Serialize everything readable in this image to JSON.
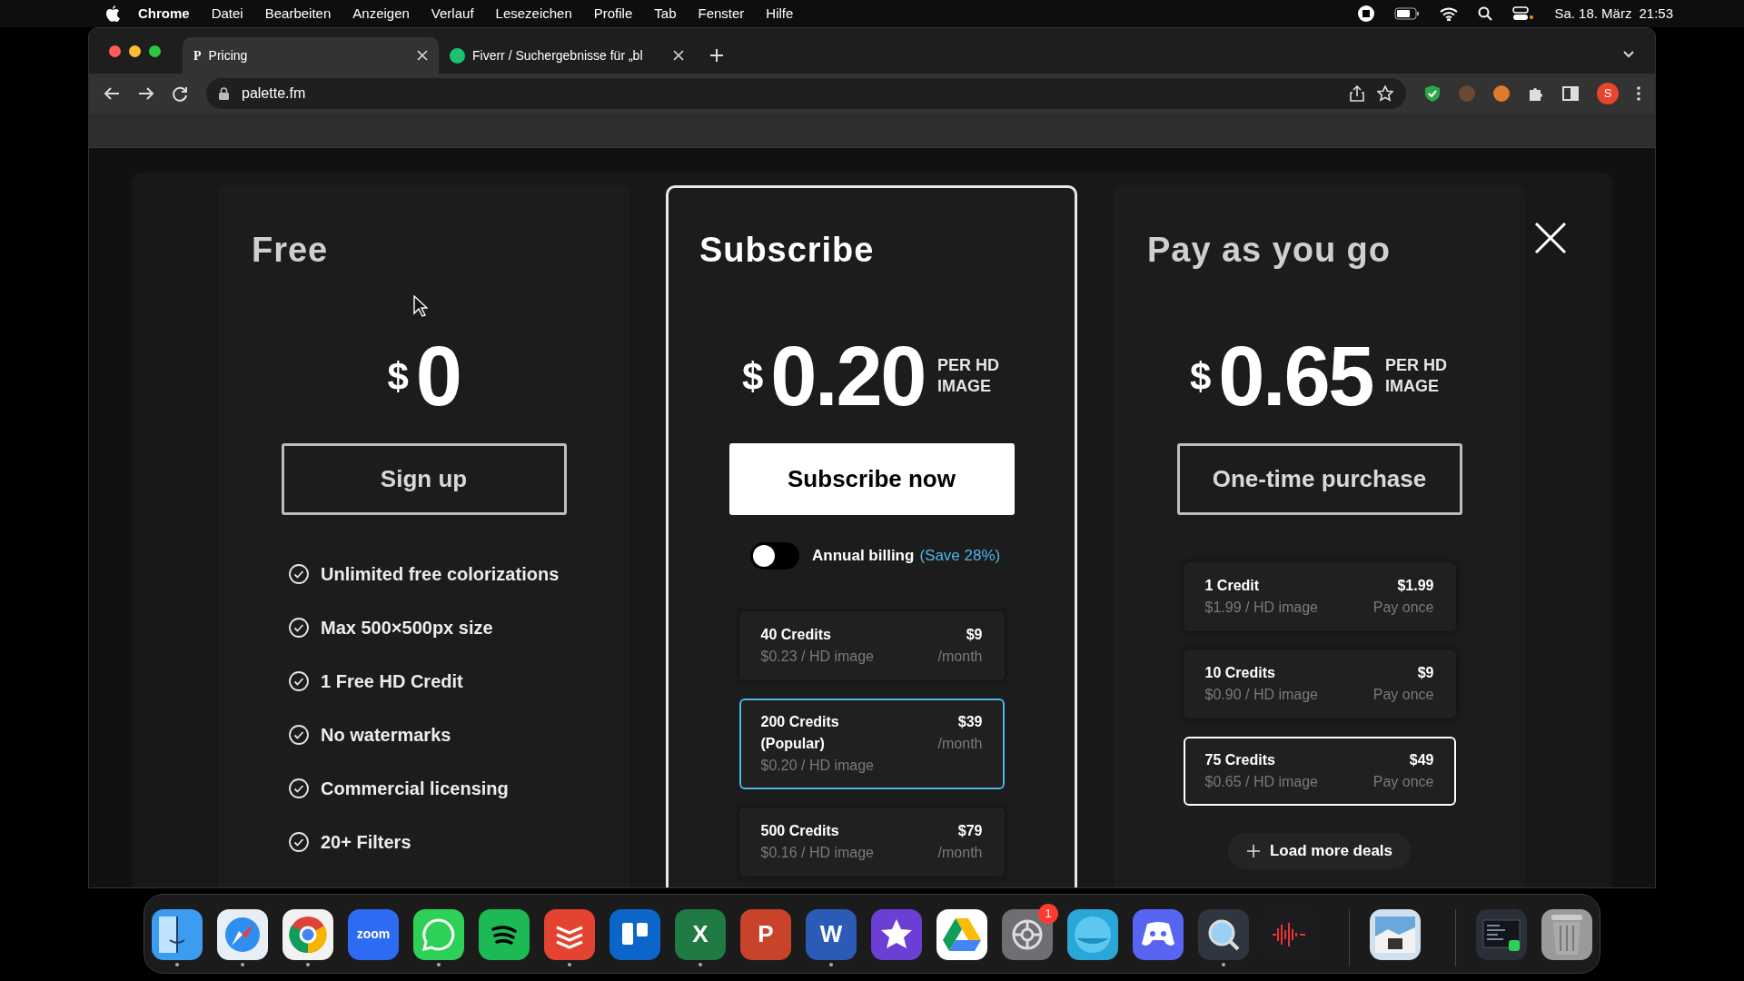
{
  "menu_bar": {
    "app": "Chrome",
    "items": [
      "Datei",
      "Bearbeiten",
      "Anzeigen",
      "Verlauf",
      "Lesezeichen",
      "Profile",
      "Tab",
      "Fenster",
      "Hilfe"
    ],
    "date": "Sa. 18. März",
    "time": "21:53"
  },
  "tabs": [
    {
      "favicon": "P",
      "kind": "letter",
      "title": "Pricing",
      "selected": true
    },
    {
      "kind": "round",
      "title": "Fiverr / Suchergebnisse für „bl",
      "selected": false
    }
  ],
  "address_bar": {
    "url": "palette.fm"
  },
  "profile": {
    "initial": "S"
  },
  "plans": [
    {
      "title": "Free",
      "currency": "$",
      "price": "0",
      "button": "Sign up",
      "selected": false,
      "features": [
        "Unlimited free colorizations",
        "Max 500×500px size",
        "1 Free HD Credit",
        "No watermarks",
        "Commercial licensing",
        "20+ Filters"
      ]
    },
    {
      "title": "Subscribe",
      "currency": "$",
      "price": "0.20",
      "unit": "PER HD IMAGE",
      "button": "Subscribe now",
      "selected": true,
      "toggle": {
        "label": "Annual billing",
        "note": "(Save 28%)",
        "on": false
      },
      "options": [
        {
          "name": "40 Credits",
          "price": "$9",
          "per": "$0.23 / HD image",
          "term": "/month",
          "selected": false
        },
        {
          "name": "200 Credits (Popular)",
          "price": "$39",
          "per": "$0.20 / HD image",
          "term": "/month",
          "selected": true
        },
        {
          "name": "500 Credits",
          "price": "$79",
          "per": "$0.16 / HD image",
          "term": "/month",
          "selected": false
        }
      ]
    },
    {
      "title": "Pay as you go",
      "currency": "$",
      "price": "0.65",
      "unit": "PER HD IMAGE",
      "button": "One-time purchase",
      "selected": false,
      "options": [
        {
          "name": "1 Credit",
          "price": "$1.99",
          "per": "$1.99 / HD image",
          "term": "Pay once",
          "selected": false
        },
        {
          "name": "10 Credits",
          "price": "$9",
          "per": "$0.90 / HD image",
          "term": "Pay once",
          "selected": false
        },
        {
          "name": "75 Credits",
          "price": "$49",
          "per": "$0.65 / HD image",
          "term": "Pay once",
          "selected": true
        }
      ],
      "more": "Load more deals"
    }
  ],
  "dock": [
    {
      "kind": "finder",
      "color": "#3b9cf0",
      "running": true
    },
    {
      "kind": "compass",
      "color": "#e8eef5",
      "running": true
    },
    {
      "kind": "chrome",
      "color": "#f2f2f2",
      "running": true
    },
    {
      "kind": "word",
      "color": "#2d6cf2",
      "label": "zoom",
      "running": false
    },
    {
      "kind": "chat",
      "color": "#2ed158",
      "running": true
    },
    {
      "kind": "waves",
      "color": "#1db954",
      "running": false
    },
    {
      "kind": "stack",
      "color": "#e44332",
      "running": true
    },
    {
      "kind": "board",
      "color": "#0c66c9",
      "running": false
    },
    {
      "kind": "letter",
      "color": "#1f7a44",
      "label": "X",
      "running": true
    },
    {
      "kind": "letter",
      "color": "#c8432a",
      "label": "P",
      "running": false
    },
    {
      "kind": "letter",
      "color": "#2b5bb7",
      "label": "W",
      "running": true
    },
    {
      "kind": "star",
      "color": "#6b3fd6",
      "running": false
    },
    {
      "kind": "triangle",
      "color": "#ffffff",
      "running": false
    },
    {
      "kind": "gear",
      "color": "#6e6e73",
      "badge": "1",
      "running": false
    },
    {
      "kind": "globe",
      "color": "#2aa7d8",
      "running": false
    },
    {
      "kind": "gamepad",
      "color": "#5865f2",
      "running": false
    },
    {
      "kind": "lens",
      "color": "#2f3640",
      "running": true
    },
    {
      "kind": "wave",
      "color": "#1c1c1e",
      "running": false
    },
    {
      "kind": "photo",
      "color": "#cfe0ee",
      "running": false
    },
    {
      "kind": "screen",
      "color": "#2a2f38",
      "running": false
    },
    {
      "kind": "trash",
      "color": "#9a9a9a",
      "running": false
    }
  ]
}
